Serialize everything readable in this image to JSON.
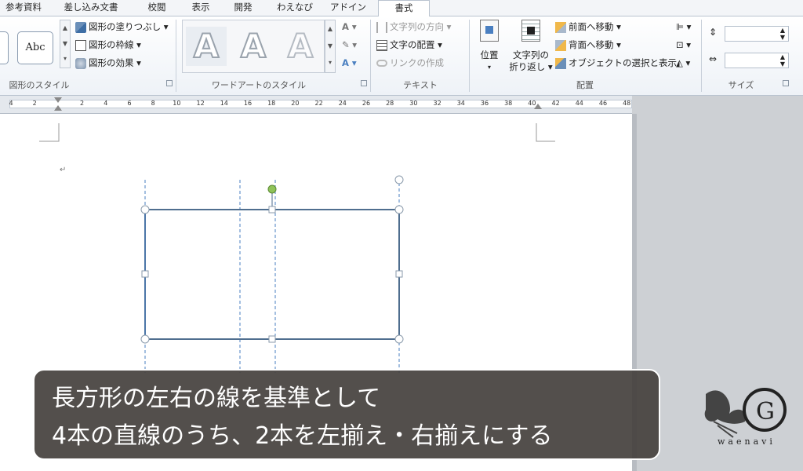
{
  "tabs": [
    {
      "label": "参考資料"
    },
    {
      "label": "差し込み文書"
    },
    {
      "label": "校閲"
    },
    {
      "label": "表示"
    },
    {
      "label": "開発"
    },
    {
      "label": "わえなび"
    },
    {
      "label": "アドイン"
    },
    {
      "label": "書式"
    }
  ],
  "ribbon": {
    "shape_styles": {
      "label": "図形のスタイル",
      "preset": "Abc",
      "fill": "図形の塗りつぶし",
      "outline": "図形の枠線",
      "effects": "図形の効果"
    },
    "wordart": {
      "label": "ワードアートのスタイル",
      "sample": "A"
    },
    "text": {
      "label": "テキスト",
      "direction": "文字列の方向",
      "align": "文字の配置",
      "link": "リンクの作成"
    },
    "arrange": {
      "label": "配置",
      "position": "位置",
      "wrap_line1": "文字列の",
      "wrap_line2": "折り返し",
      "bring_forward": "前面へ移動",
      "send_backward": "背面へ移動",
      "selection_pane": "オブジェクトの選択と表示"
    },
    "size": {
      "label": "サイズ",
      "height": "",
      "width": ""
    }
  },
  "ruler": {
    "ticks": [
      "4",
      "2",
      "",
      "2",
      "4",
      "6",
      "8",
      "10",
      "12",
      "14",
      "16",
      "18",
      "20",
      "22",
      "24",
      "26",
      "28",
      "30",
      "32",
      "34",
      "36",
      "38",
      "40",
      "42",
      "44",
      "46",
      "48"
    ]
  },
  "document": {
    "paragraph_mark": "↵"
  },
  "caption": {
    "line1": "長方形の左右の線を基準として",
    "line2": "4本の直線のうち、2本を左揃え・右揃えにする"
  },
  "logo": {
    "text": "waenavi"
  },
  "colors": {
    "guide": "#4a7fc0",
    "shape_outline": "#4f6e8f",
    "rotate_handle": "#8fc35a"
  }
}
